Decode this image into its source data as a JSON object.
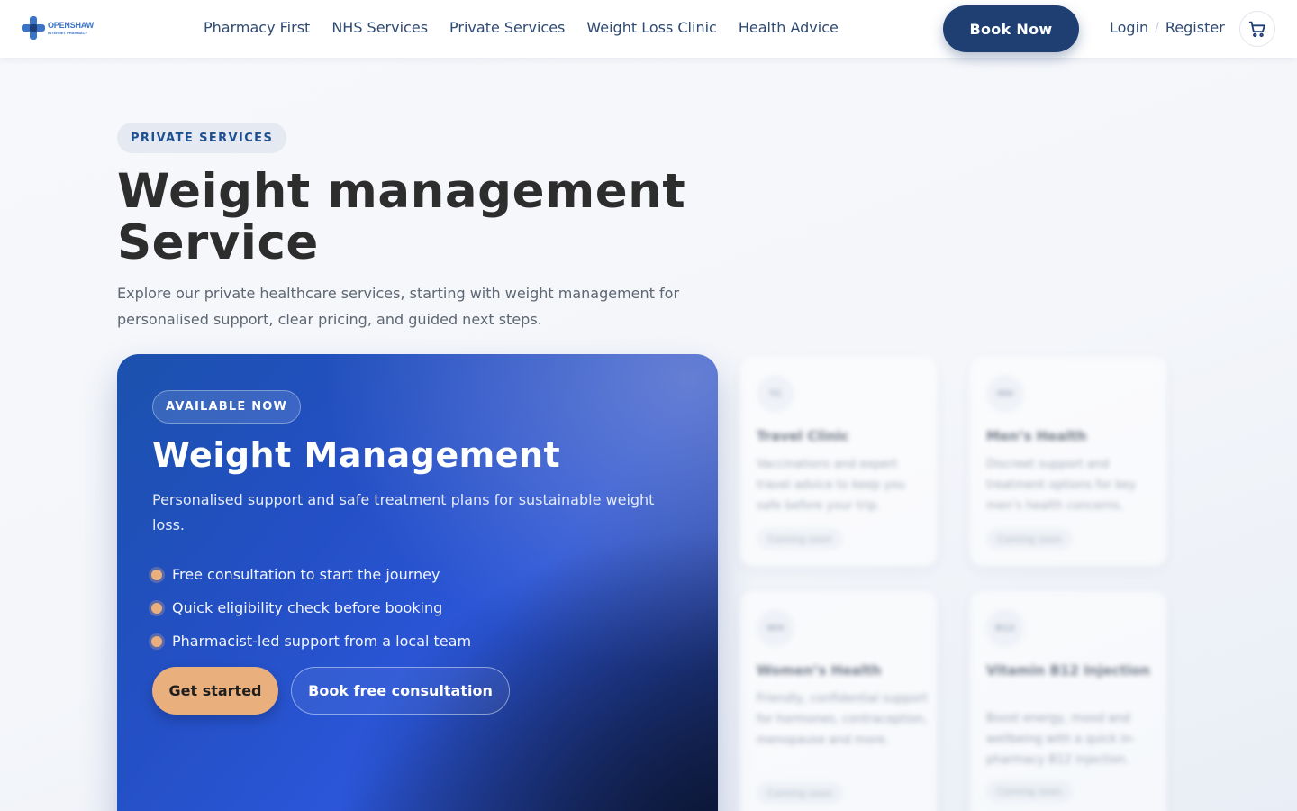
{
  "header": {
    "logo_alt": "Openshaw",
    "logo_line1": "OPENSHAW",
    "logo_line2": "INTERNET PHARMACY",
    "nav": [
      "Pharmacy First",
      "NHS Services",
      "Private Services",
      "Weight Loss Clinic",
      "Health Advice"
    ],
    "book_now": "Book Now",
    "login": "Login",
    "separator": "/",
    "register": "Register",
    "cart_icon": "cart-icon"
  },
  "hero": {
    "eyebrow": "PRIVATE SERVICES",
    "title": "Weight management Service",
    "subtitle": "Explore our private healthcare services, starting with weight management for personalised support, clear pricing, and guided next steps."
  },
  "feature": {
    "badge": "AVAILABLE NOW",
    "title": "Weight Management",
    "description": "Personalised support and safe treatment plans for sustainable weight loss.",
    "bullets": [
      "Free consultation to start the journey",
      "Quick eligibility check before booking",
      "Pharmacist-led support from a local team"
    ],
    "primary_button": "Get started",
    "secondary_button": "Book free consultation",
    "accent_color": "#e9b07e"
  },
  "services": [
    {
      "badge": "TC",
      "title": "Travel Clinic",
      "description": "Vaccinations and expert travel advice to keep you safe before your trip.",
      "status": "Coming soon"
    },
    {
      "badge": "MH",
      "title": "Men’s Health",
      "description": "Discreet support and treatment options for key men’s health concerns.",
      "status": "Coming soon"
    },
    {
      "badge": "WH",
      "title": "Women’s Health",
      "description": "Friendly, confidential support for hormones, contraception, menopause and more.",
      "status": "Coming soon"
    },
    {
      "badge": "B12",
      "title": "Vitamin B12 Injection",
      "description": "Boost energy, mood and wellbeing with a quick in-pharmacy B12 injection.",
      "status": "Coming soon"
    }
  ],
  "colors": {
    "primary": "#1f3f73",
    "nav_text": "#2f4a73",
    "eyebrow_text": "#1d4f91",
    "feature_gradient_start": "#1b51ad",
    "feature_gradient_end": "#182a5c"
  }
}
